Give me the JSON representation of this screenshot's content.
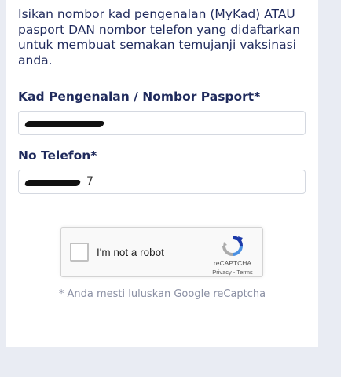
{
  "form": {
    "intro": "Isikan nombor kad pengenalan (MyKad) ATAU pasport DAN nombor telefon yang didaftarkan untuk membuat semakan temujanji vaksinasi anda.",
    "ic_label": "Kad Pengenalan / Nombor Pasport*",
    "ic_value": "",
    "phone_label": "No Telefon*",
    "phone_value_visible": "7"
  },
  "recaptcha": {
    "label": "I'm not a robot",
    "brand": "reCAPTCHA",
    "privacy": "Privacy",
    "separator": " - ",
    "terms": "Terms",
    "checked": false
  },
  "note": "* Anda mesti luluskan Google reCaptcha",
  "colors": {
    "text_primary": "#1f2a5c",
    "page_bg": "#e9ecf3",
    "card_bg": "#ffffff",
    "note_text": "#8a8fa3"
  }
}
